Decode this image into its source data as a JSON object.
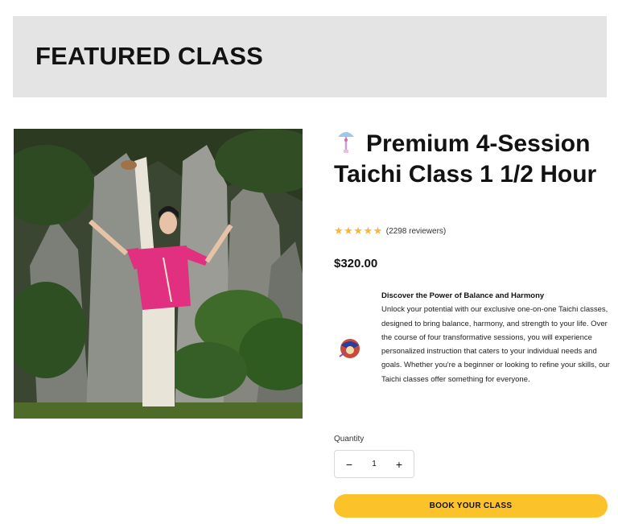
{
  "banner": {
    "title": "FEATURED CLASS"
  },
  "product": {
    "title": "Premium 4-Session Taichi Class 1 1/2 Hour",
    "title_icon": "tai-chi-fan-icon",
    "rating": {
      "stars": "★★★★★",
      "value": 5,
      "reviewers": "(2298 reviewers)"
    },
    "price": "$320.00",
    "description": {
      "icon": "fan-emblem-icon",
      "heading": "Discover the Power of Balance and Harmony",
      "body": "Unlock your potential with our exclusive one-on-one Taichi classes, designed to bring balance, harmony, and strength to your life. Over the course of four transformative sessions, you will experience personalized instruction that caters to your individual needs and goals. Whether you're a beginner or looking to refine your skills, our Taichi classes offer something for everyone."
    },
    "quantity": {
      "label": "Quantity",
      "value": "1",
      "minus": "−",
      "plus": "+"
    },
    "cta": "BOOK YOUR CLASS"
  },
  "colors": {
    "banner_bg": "#e4e4e4",
    "cta": "#fcc22a",
    "stars": "#f5b83f",
    "shirt": "#e0307f"
  }
}
